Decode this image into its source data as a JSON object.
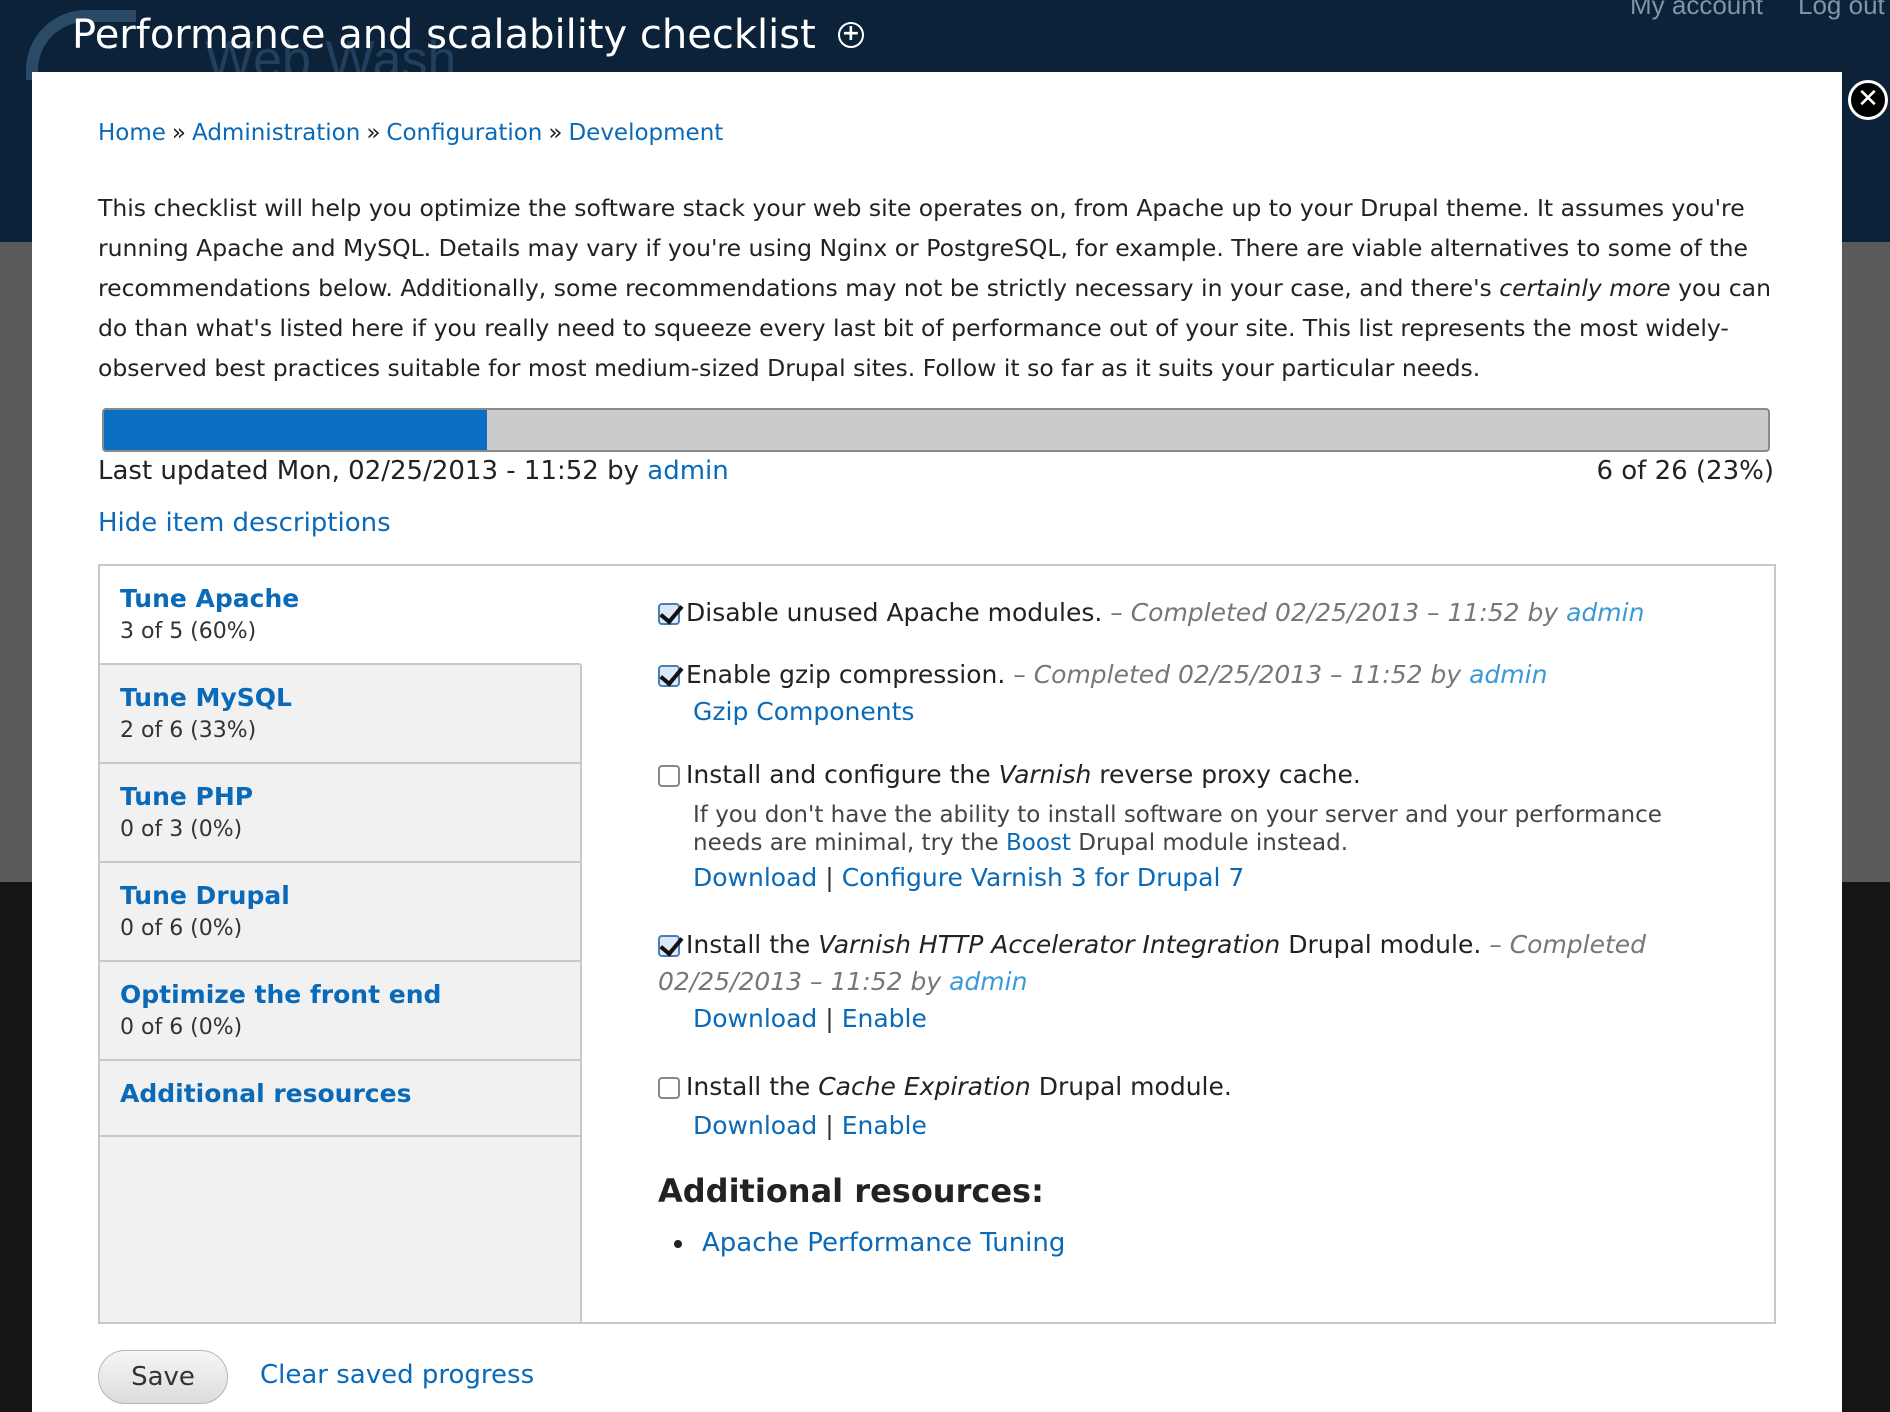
{
  "background": {
    "account_links": [
      "My account",
      "Log out"
    ],
    "site_name": "Web Wash"
  },
  "overlay": {
    "title": "Performance and scalability checklist",
    "shortcut_icon": "add-shortcut-icon",
    "close_icon": "close-icon"
  },
  "breadcrumb": [
    "Home",
    "Administration",
    "Configuration",
    "Development"
  ],
  "breadcrumb_separator": "»",
  "intro": {
    "part1": "This checklist will help you optimize the software stack your web site operates on, from Apache up to your Drupal theme. It assumes you're running Apache and MySQL. Details may vary if you're using Nginx or PostgreSQL, for example. There are viable alternatives to some of the recommendations below. Additionally, some recommendations may not be strictly necessary in your case, and there's ",
    "emphasis": "certainly more",
    "part2": " you can do than what's listed here if you really need to squeeze every last bit of performance out of your site. This list represents the most widely-observed best practices suitable for most medium-sized Drupal sites. Follow it so far as it suits your particular needs."
  },
  "progress": {
    "fraction": 0.23,
    "last_updated_prefix": "Last updated Mon, 02/25/2013 - 11:52 by",
    "last_updated_user": "admin",
    "count_text": "6 of 26 (23%)"
  },
  "hide_descriptions_label": "Hide item descriptions",
  "tabs": [
    {
      "title": "Tune Apache",
      "count": "3 of 5 (60%)"
    },
    {
      "title": "Tune MySQL",
      "count": "2 of 6 (33%)"
    },
    {
      "title": "Tune PHP",
      "count": "0 of 3 (0%)"
    },
    {
      "title": "Tune Drupal",
      "count": "0 of 6 (0%)"
    },
    {
      "title": "Optimize the front end",
      "count": "0 of 6 (0%)"
    },
    {
      "title": "Additional resources",
      "count": ""
    }
  ],
  "items": [
    {
      "checked": true,
      "label": "Disable unused Apache modules.",
      "completed": " – Completed 02/25/2013 – 11:52 by ",
      "completed_user": "admin"
    },
    {
      "checked": true,
      "label": "Enable gzip compression.",
      "completed": " – Completed 02/25/2013 – 11:52 by ",
      "completed_user": "admin",
      "link": "Gzip Components"
    },
    {
      "checked": false,
      "label_pre": "Install and configure the ",
      "label_em": "Varnish",
      "label_post": " reverse proxy cache.",
      "desc_pre": "If you don't have the ability to install software on your server and your performance needs are minimal, try the ",
      "desc_link": "Boost",
      "desc_post": " Drupal module instead.",
      "link1": "Download",
      "link2": "Configure Varnish 3 for Drupal 7"
    },
    {
      "checked": true,
      "label_pre": "Install the ",
      "label_em": "Varnish HTTP Accelerator Integration",
      "label_post": " Drupal module.",
      "completed_a": " – Completed",
      "completed_b": "02/25/2013 – 11:52 by ",
      "completed_user": "admin",
      "link1": "Download",
      "link2": "Enable"
    },
    {
      "checked": false,
      "label_pre": "Install the ",
      "label_em": "Cache Expiration",
      "label_post": " Drupal module.",
      "link1": "Download",
      "link2": "Enable"
    }
  ],
  "link_separator": "|",
  "resources": {
    "heading": "Additional resources:",
    "links": [
      "Apache Performance Tuning"
    ]
  },
  "actions": {
    "save_label": "Save",
    "clear_label": "Clear saved progress"
  }
}
